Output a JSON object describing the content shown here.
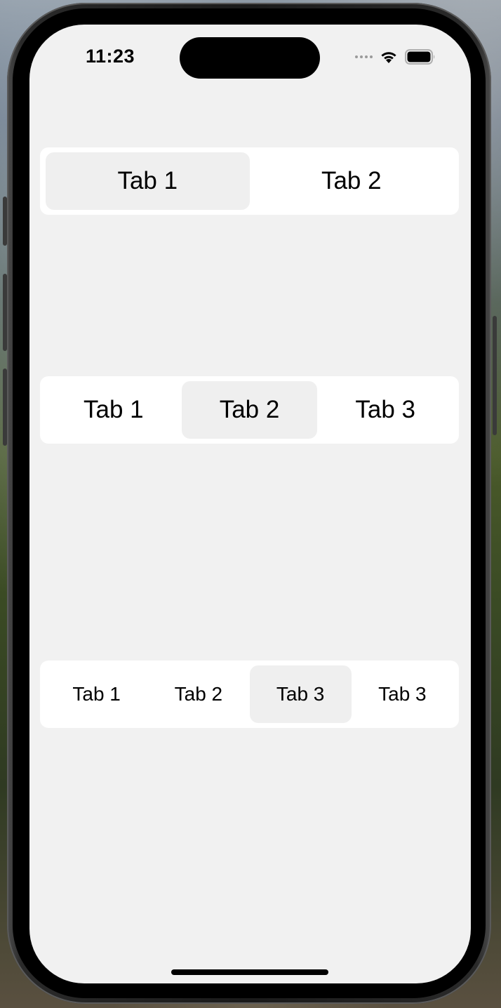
{
  "status_bar": {
    "time": "11:23",
    "icons": [
      "signal-dots-icon",
      "wifi-icon",
      "battery-icon"
    ]
  },
  "segmented_controls": [
    {
      "tabs": [
        "Tab 1",
        "Tab 2"
      ],
      "selected": "Tab 1"
    },
    {
      "tabs": [
        "Tab 1",
        "Tab 2",
        "Tab 3"
      ],
      "selected": "Tab 2"
    },
    {
      "tabs": [
        "Tab 1",
        "Tab 2",
        "Tab 3",
        "Tab 3"
      ],
      "selected_index": 2
    }
  ],
  "colors": {
    "screen_background": "#f1f1f1",
    "control_background": "#ffffff",
    "selected_segment": "#efefef",
    "text": "#000000"
  }
}
